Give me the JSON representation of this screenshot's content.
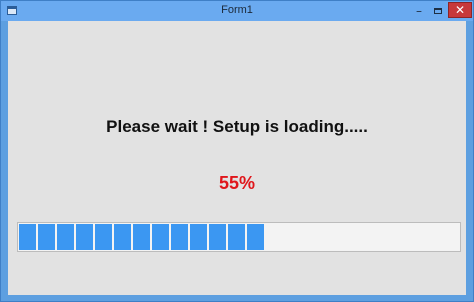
{
  "window": {
    "title": "Form1",
    "minimize_label": "–",
    "close_label": "✕"
  },
  "message": "Please wait ! Setup is loading.....",
  "progress": {
    "percent_text": "55%",
    "fraction": 0.55,
    "segment_count_total": 24
  },
  "colors": {
    "percent_text": "#e0161b",
    "progress_fill": "#3b97f2",
    "title_bar": "#6aaaf0",
    "client_background": "#e2e2e2"
  }
}
